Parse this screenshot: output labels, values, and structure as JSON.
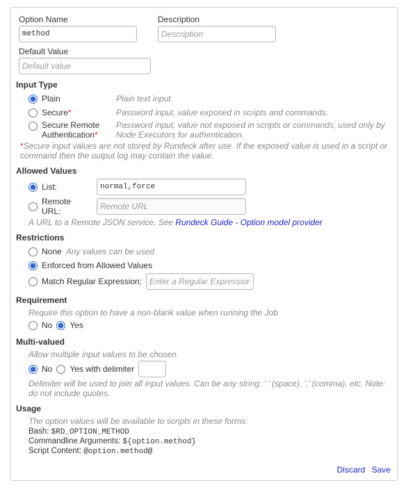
{
  "fields": {
    "option_name_label": "Option Name",
    "option_name_value": "method",
    "description_label": "Description",
    "description_placeholder": "Description",
    "default_value_label": "Default Value",
    "default_value_placeholder": "Default value"
  },
  "input_type": {
    "title": "Input Type",
    "plain": {
      "label": "Plain",
      "desc": "Plain text input."
    },
    "secure": {
      "label": "Secure",
      "ast": "*",
      "desc": "Password input, value exposed in scripts and commands."
    },
    "secure_remote": {
      "label": "Secure Remote Authentication",
      "ast": "*",
      "desc": "Password input, value not exposed in scripts or commands, used only by Node Executors for authentication."
    },
    "footnote_ast": "*",
    "footnote": "Secure input values are not stored by Rundeck after use. If the exposed value is used in a script or command then the output log may contain the value."
  },
  "allowed": {
    "title": "Allowed Values",
    "list_label": "List:",
    "list_value": "normal,force",
    "remote_label": "Remote URL:",
    "remote_placeholder": "Remote URL",
    "help_prefix": "A URL to a Remote JSON service. See ",
    "help_link": "Rundeck Guide - Option model provider"
  },
  "restrict": {
    "title": "Restrictions",
    "none_label": "None",
    "none_desc": "Any values can be used",
    "enforced_label": "Enforced from Allowed Values",
    "regex_label": "Match Regular Expression:",
    "regex_placeholder": "Enter a Regular Expression"
  },
  "req": {
    "title": "Requirement",
    "help": "Require this option to have a non-blank value when running the Job",
    "no": "No",
    "yes": "Yes"
  },
  "multi": {
    "title": "Multi-valued",
    "help": "Allow multiple input values to be chosen.",
    "no": "No",
    "yes": "Yes with delimiter",
    "delim_help": "Delimiter will be used to join all input values. Can be any string: ' ' (space), ',' (comma), etc. Note: do not include quotes."
  },
  "usage": {
    "title": "Usage",
    "help": "The option values will be available to scripts in these forms:",
    "bash_label": "Bash:",
    "bash_code": "$RD_OPTION_METHOD",
    "cmd_label": "Commandline Arguments:",
    "cmd_code": "${option.method}",
    "script_label": "Script Content:",
    "script_code": "@option.method@"
  },
  "actions": {
    "discard": "Discard",
    "save": "Save"
  }
}
